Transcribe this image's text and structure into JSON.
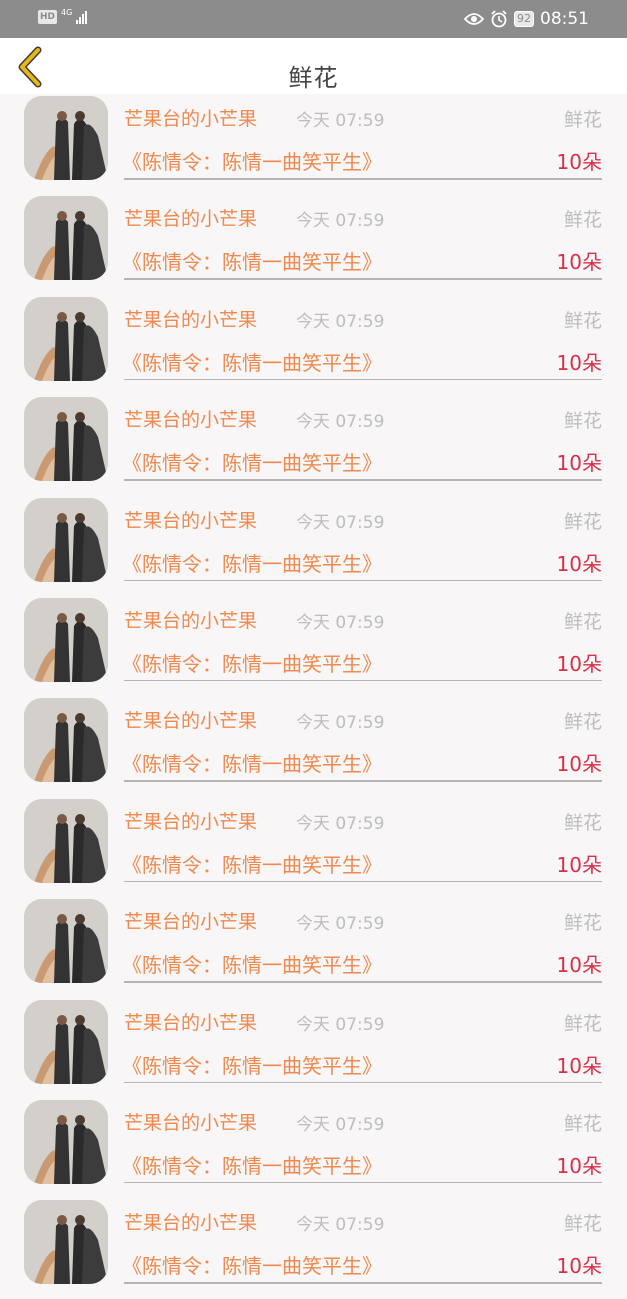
{
  "status_bar": {
    "hd": "HD",
    "network": "4G",
    "battery": "92",
    "time": "08:51"
  },
  "header": {
    "title": "鲜花",
    "back_icon": "chevron-left-icon"
  },
  "colors": {
    "accent_orange": "#ee8a4f",
    "count_red": "#d6304a",
    "muted_gray": "#bdbdbd",
    "back_yellow": "#e8b615"
  },
  "list": {
    "items": [
      {
        "user": "芒果台的小芒果",
        "time": "今天 07:59",
        "gift": "鲜花",
        "show": "《陈情令：陈情一曲笑平生》",
        "count": "10朵"
      },
      {
        "user": "芒果台的小芒果",
        "time": "今天 07:59",
        "gift": "鲜花",
        "show": "《陈情令：陈情一曲笑平生》",
        "count": "10朵"
      },
      {
        "user": "芒果台的小芒果",
        "time": "今天 07:59",
        "gift": "鲜花",
        "show": "《陈情令：陈情一曲笑平生》",
        "count": "10朵"
      },
      {
        "user": "芒果台的小芒果",
        "time": "今天 07:59",
        "gift": "鲜花",
        "show": "《陈情令：陈情一曲笑平生》",
        "count": "10朵"
      },
      {
        "user": "芒果台的小芒果",
        "time": "今天 07:59",
        "gift": "鲜花",
        "show": "《陈情令：陈情一曲笑平生》",
        "count": "10朵"
      },
      {
        "user": "芒果台的小芒果",
        "time": "今天 07:59",
        "gift": "鲜花",
        "show": "《陈情令：陈情一曲笑平生》",
        "count": "10朵"
      },
      {
        "user": "芒果台的小芒果",
        "time": "今天 07:59",
        "gift": "鲜花",
        "show": "《陈情令：陈情一曲笑平生》",
        "count": "10朵"
      },
      {
        "user": "芒果台的小芒果",
        "time": "今天 07:59",
        "gift": "鲜花",
        "show": "《陈情令：陈情一曲笑平生》",
        "count": "10朵"
      },
      {
        "user": "芒果台的小芒果",
        "time": "今天 07:59",
        "gift": "鲜花",
        "show": "《陈情令：陈情一曲笑平生》",
        "count": "10朵"
      },
      {
        "user": "芒果台的小芒果",
        "time": "今天 07:59",
        "gift": "鲜花",
        "show": "《陈情令：陈情一曲笑平生》",
        "count": "10朵"
      },
      {
        "user": "芒果台的小芒果",
        "time": "今天 07:59",
        "gift": "鲜花",
        "show": "《陈情令：陈情一曲笑平生》",
        "count": "10朵"
      },
      {
        "user": "芒果台的小芒果",
        "time": "今天 07:59",
        "gift": "鲜花",
        "show": "《陈情令：陈情一曲笑平生》",
        "count": "10朵"
      }
    ]
  }
}
